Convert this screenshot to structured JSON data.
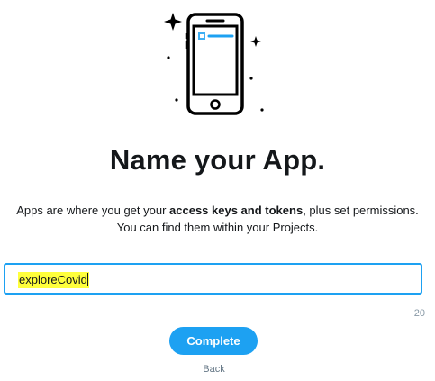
{
  "illustration": {
    "icon": "mobile-phone-icon"
  },
  "header": {
    "title": "Name your App."
  },
  "description": {
    "part1": "Apps are where you get your ",
    "bold": "access keys and tokens",
    "part2": ", plus set permissions.",
    "line2": "You can find them within your Projects."
  },
  "app_name_input": {
    "value": "exploreCovid",
    "char_counter": "20"
  },
  "actions": {
    "complete_label": "Complete",
    "back_label": "Back"
  },
  "colors": {
    "accent": "#1da1f2",
    "highlight": "#ffff3c",
    "text": "#14171a",
    "muted": "#8899a6"
  }
}
